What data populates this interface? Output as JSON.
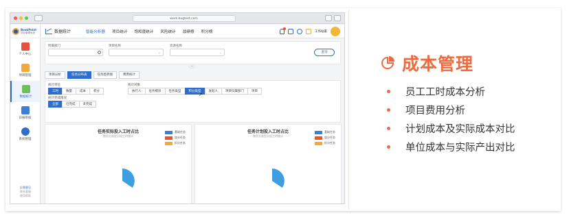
{
  "browser": {
    "url": "work.bugtest.com"
  },
  "app": {
    "logo_name": "BookPoint",
    "logo_sub": "项目管理系统",
    "module_title": "数据统计",
    "nav": [
      "智能分析器",
      "项目统计",
      "饱和度统计",
      "风险统计",
      "战绩榜",
      "积分榜"
    ],
    "user_label": "工作站家",
    "sidebar": [
      {
        "label": "个人中心"
      },
      {
        "label": "项目管理"
      },
      {
        "label": "数据统计"
      },
      {
        "label": "日报审核"
      },
      {
        "label": "系统管理"
      }
    ],
    "sidebar_foot": {
      "link": "反馈意见",
      "line1": "联系客服",
      "line2": "使用帮助"
    }
  },
  "filter": {
    "dept_label": "所属部门",
    "project_label": "项目名称",
    "resource_label": "资源名称",
    "query_button": "查询"
  },
  "tabs": [
    "项目分析",
    "任务分布表",
    "任务趋势图",
    "费用统计"
  ],
  "tabs_active": 1,
  "options": {
    "unit_label": "统计单位",
    "unit_items": [
      "工时",
      "数量",
      "成本",
      "积分"
    ],
    "object_label": "统计对象",
    "object_items": [
      "执行人",
      "任务模块",
      "任务类型",
      "积分类型",
      "发起人",
      "项目归属部门",
      "项目"
    ],
    "status_label": "统计完成情况",
    "status_items": [
      "全部",
      "已完成",
      "未完成"
    ]
  },
  "panels": [
    {
      "title": "任务实际投入工时占比",
      "subtitle": "按积分类型分组工时统计",
      "legend": [
        "基础任务",
        "加分任务",
        "扣分任务"
      ]
    },
    {
      "title": "任务计划投入工时占比",
      "subtitle": "按积分类型分组工时统计",
      "legend": [
        "基础任务",
        "加分任务",
        "扣分任务"
      ]
    }
  ],
  "colors": {
    "accent": "#ee6b3f",
    "primary": "#2f6dcc",
    "pie": "#3d9ee0",
    "legend": [
      "#3d7fd0",
      "#e5562e",
      "#f2a93b"
    ]
  },
  "slide": {
    "title": "成本管理",
    "bullets": [
      "员工工时成本分析",
      "项目费用分析",
      "计划成本及实际成本对比",
      "单位成本与实际产出对比"
    ]
  }
}
